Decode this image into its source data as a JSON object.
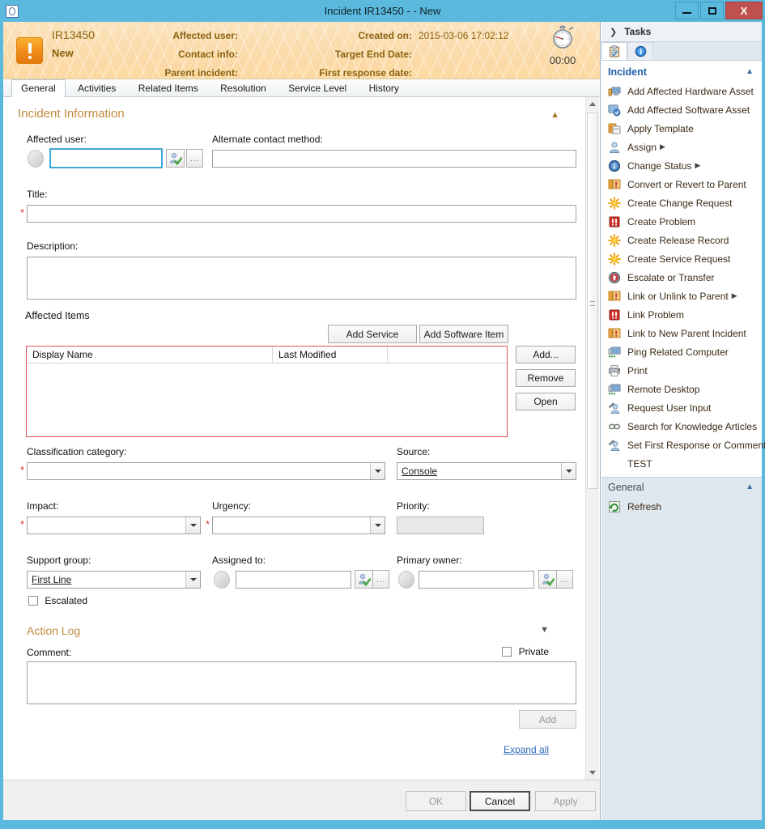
{
  "window": {
    "title": "Incident IR13450 -  - New",
    "icon": "incident-window-icon",
    "minimize": "–",
    "maximize": "□",
    "close": "X"
  },
  "banner": {
    "id": "IR13450",
    "status": "New",
    "labels_left": [
      "Affected user:",
      "Contact info:",
      "Parent incident:"
    ],
    "labels_right": [
      "Created on:",
      "Target End Date:",
      "First response date:"
    ],
    "values_right": [
      "2015-03-06 17:02:12",
      "",
      ""
    ],
    "timer": "00:00",
    "timer_icon": "stopwatch-icon"
  },
  "tabs": [
    {
      "label": "General",
      "active": true
    },
    {
      "label": "Activities",
      "active": false
    },
    {
      "label": "Related Items",
      "active": false
    },
    {
      "label": "Resolution",
      "active": false
    },
    {
      "label": "Service Level",
      "active": false
    },
    {
      "label": "History",
      "active": false
    }
  ],
  "form": {
    "section_title": "Incident Information",
    "affected_user": {
      "label": "Affected user:",
      "value": "",
      "picker": "user-picker-icon",
      "browse": "..."
    },
    "alternate_contact": {
      "label": "Alternate contact method:",
      "value": ""
    },
    "title_field": {
      "label": "Title:",
      "value": "",
      "required": "*"
    },
    "description": {
      "label": "Description:",
      "value": ""
    },
    "affected_items": {
      "label": "Affected Items",
      "add_service": "Add Service",
      "add_software_item": "Add Software Item",
      "columns": [
        "Display Name",
        "Last Modified",
        ""
      ],
      "rows": [],
      "side_buttons": [
        "Add...",
        "Remove",
        "Open"
      ]
    },
    "classification_category": {
      "label": "Classification category:",
      "value": "",
      "required": "*"
    },
    "source": {
      "label": "Source:",
      "value": "Console"
    },
    "impact": {
      "label": "Impact:",
      "value": "",
      "required": "*"
    },
    "urgency": {
      "label": "Urgency:",
      "value": "",
      "required": "*"
    },
    "priority": {
      "label": "Priority:",
      "value": ""
    },
    "support_group": {
      "label": "Support group:",
      "value": "First Line"
    },
    "assigned_to": {
      "label": "Assigned to:",
      "value": ""
    },
    "primary_owner": {
      "label": "Primary owner:",
      "value": ""
    },
    "escalated": {
      "label": "Escalated",
      "checked": false
    },
    "action_log": {
      "label": "Action Log"
    },
    "comment": {
      "label": "Comment:",
      "value": ""
    },
    "private": {
      "label": "Private",
      "checked": false
    },
    "add_comment_button": "Add",
    "expand_all": "Expand all"
  },
  "footer": {
    "ok": "OK",
    "cancel": "Cancel",
    "apply": "Apply"
  },
  "task_pane": {
    "header": "Tasks",
    "tab_icons": [
      "clipboard-tasks-icon",
      "info-details-icon"
    ],
    "groups": [
      {
        "title": "Incident",
        "items": [
          {
            "label": "Add Affected Hardware Asset",
            "icon": "hardware-asset-icon",
            "submenu": false
          },
          {
            "label": "Add Affected Software Asset",
            "icon": "software-asset-icon",
            "submenu": false
          },
          {
            "label": "Apply Template",
            "icon": "template-icon",
            "submenu": false
          },
          {
            "label": "Assign",
            "icon": "user-assign-icon",
            "submenu": true
          },
          {
            "label": "Change Status",
            "icon": "status-info-icon",
            "submenu": true
          },
          {
            "label": "Convert or Revert to Parent",
            "icon": "parent-convert-icon",
            "submenu": false
          },
          {
            "label": "Create Change Request",
            "icon": "sunburst-icon",
            "submenu": false
          },
          {
            "label": "Create Problem",
            "icon": "problem-icon",
            "submenu": false
          },
          {
            "label": "Create Release Record",
            "icon": "sunburst-icon",
            "submenu": false
          },
          {
            "label": "Create Service Request",
            "icon": "sunburst-icon",
            "submenu": false
          },
          {
            "label": "Escalate or Transfer",
            "icon": "escalate-icon",
            "submenu": false
          },
          {
            "label": "Link or Unlink to Parent",
            "icon": "parent-link-icon",
            "submenu": true
          },
          {
            "label": "Link Problem",
            "icon": "problem-icon",
            "submenu": false
          },
          {
            "label": "Link to New Parent Incident",
            "icon": "parent-link-icon",
            "submenu": false
          },
          {
            "label": "Ping Related Computer",
            "icon": "computer-ping-icon",
            "submenu": false
          },
          {
            "label": "Print",
            "icon": "printer-icon",
            "submenu": false
          },
          {
            "label": "Remote Desktop",
            "icon": "computer-ping-icon",
            "submenu": false
          },
          {
            "label": "Request User Input",
            "icon": "user-input-icon",
            "submenu": false
          },
          {
            "label": "Search for Knowledge Articles",
            "icon": "knowledge-search-icon",
            "submenu": false
          },
          {
            "label": "Set First Response or Comment",
            "icon": "user-input-icon",
            "submenu": false
          },
          {
            "label": "TEST",
            "icon": "none",
            "submenu": false
          }
        ]
      },
      {
        "title": "General",
        "items": [
          {
            "label": "Refresh",
            "icon": "refresh-icon",
            "submenu": false
          }
        ]
      }
    ]
  },
  "colors": {
    "window_frame": "#5bb9dd",
    "banner_gradient_start": "#fbe3bd",
    "banner_text": "#8a6413",
    "required_asterisk": "#e03030",
    "grid_border_red": "#e0534f",
    "task_group_blue": "#1f5fa8",
    "close_button": "#c0504d"
  }
}
